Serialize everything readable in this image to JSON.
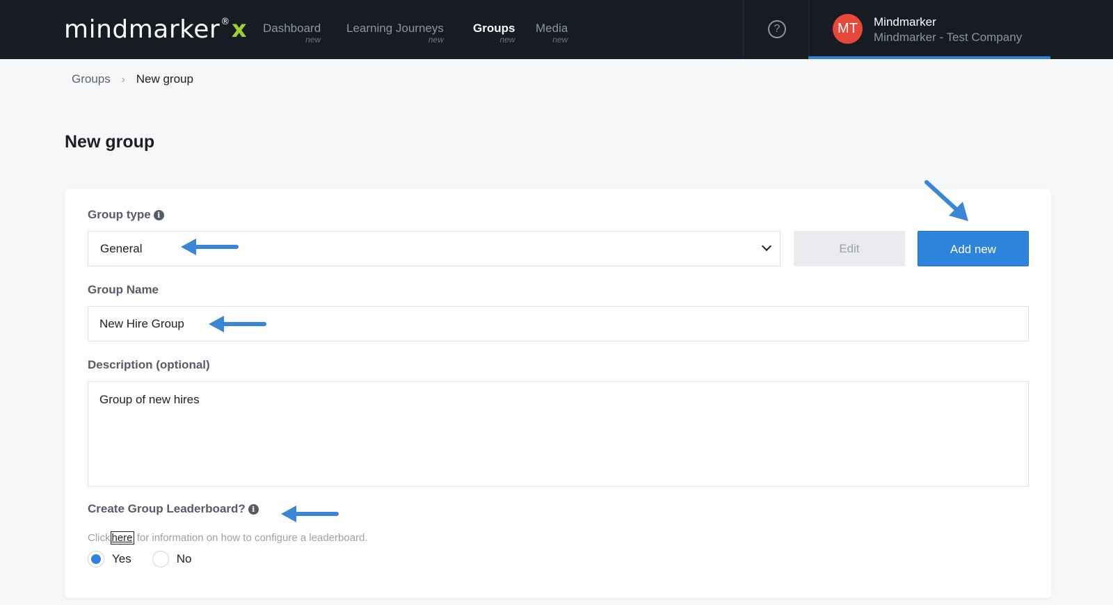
{
  "brand": {
    "name": "mindmarker",
    "reg": "®",
    "x": "x",
    "accent": "#9bd02f"
  },
  "nav": {
    "items": [
      {
        "label": "Dashboard",
        "tag": "new"
      },
      {
        "label": "Learning Journeys",
        "tag": "new"
      },
      {
        "label": "Groups",
        "tag": "new",
        "active": true
      },
      {
        "label": "Media",
        "tag": "new"
      }
    ],
    "help_icon": "question-circle-icon",
    "user": {
      "initials": "MT",
      "name": "Mindmarker",
      "company": "Mindmarker - Test Company",
      "avatar_color": "#e8483a"
    }
  },
  "breadcrumb": {
    "parent": "Groups",
    "separator": "›",
    "current": "New group"
  },
  "page": {
    "title": "New group"
  },
  "form": {
    "group_type": {
      "label": "Group type",
      "info_icon": "info-icon",
      "selected": "General",
      "edit_label": "Edit",
      "add_label": "Add new"
    },
    "group_name": {
      "label": "Group Name",
      "value": "New Hire Group"
    },
    "description": {
      "label": "Description (optional)",
      "value": "Group of new hires"
    },
    "leaderboard": {
      "label": "Create Group Leaderboard?",
      "helper_prefix": "Click",
      "helper_link": "here",
      "helper_suffix": "for information on how to configure a leaderboard.",
      "options": [
        {
          "label": "Yes",
          "checked": true
        },
        {
          "label": "No",
          "checked": false
        }
      ]
    }
  },
  "colors": {
    "primary": "#2d84dd",
    "topbar": "#161b24",
    "annotation_arrow": "#3a86d6"
  }
}
